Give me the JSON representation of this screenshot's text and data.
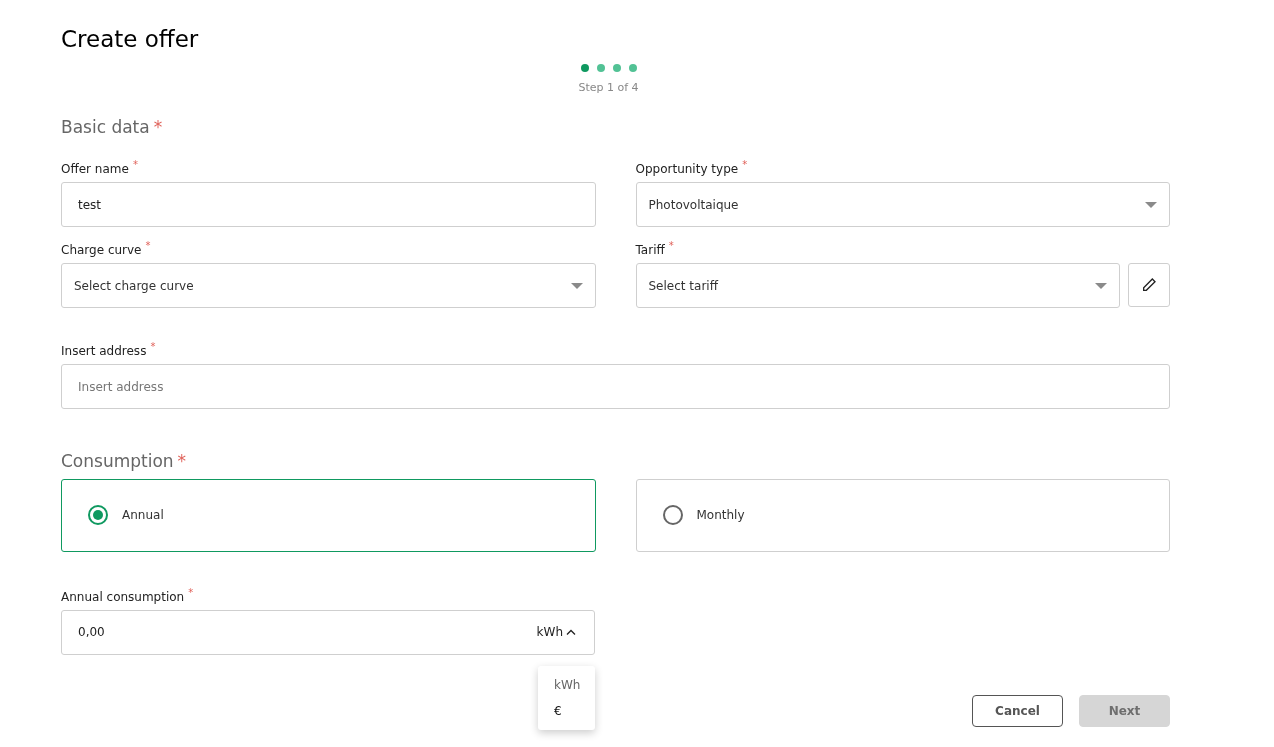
{
  "title": "Create offer",
  "stepper": {
    "steps": [
      {
        "selected": true
      },
      {
        "selected": false
      },
      {
        "selected": false
      },
      {
        "selected": false
      }
    ],
    "label": "Step 1 of 4"
  },
  "basic_data": {
    "heading": "Basic data",
    "mark": "*",
    "fields": [
      {
        "kind": "text",
        "label": "Offer name",
        "mark": "*",
        "value": "test"
      },
      {
        "kind": "select",
        "label": "Opportunity type",
        "mark": "*",
        "value": "Photovoltaique"
      },
      {
        "kind": "select",
        "label": "Charge curve",
        "mark": "*",
        "placeholder": "Select charge curve"
      },
      {
        "kind": "select_edit",
        "label": "Tariff",
        "mark": "*",
        "placeholder": "Select tariff"
      }
    ],
    "address": {
      "label": "Insert address",
      "mark": "*",
      "placeholder": "Insert address"
    }
  },
  "consumption": {
    "heading": "Consumption",
    "mark": "*",
    "options": [
      {
        "label": "Annual",
        "selected": true
      },
      {
        "label": "Monthly",
        "selected": false
      }
    ],
    "field": {
      "label": "Annual consumption",
      "mark": "*",
      "value": "0,00",
      "unit": "kWh",
      "expanded": true,
      "unit_options": [
        {
          "label": "kWh",
          "selected": true
        },
        {
          "label": "€",
          "selected": false
        }
      ]
    }
  },
  "buttons": [
    {
      "kind": "secondary",
      "label": "Cancel",
      "disabled": false
    },
    {
      "kind": "primary",
      "label": "Next",
      "disabled": true
    }
  ]
}
